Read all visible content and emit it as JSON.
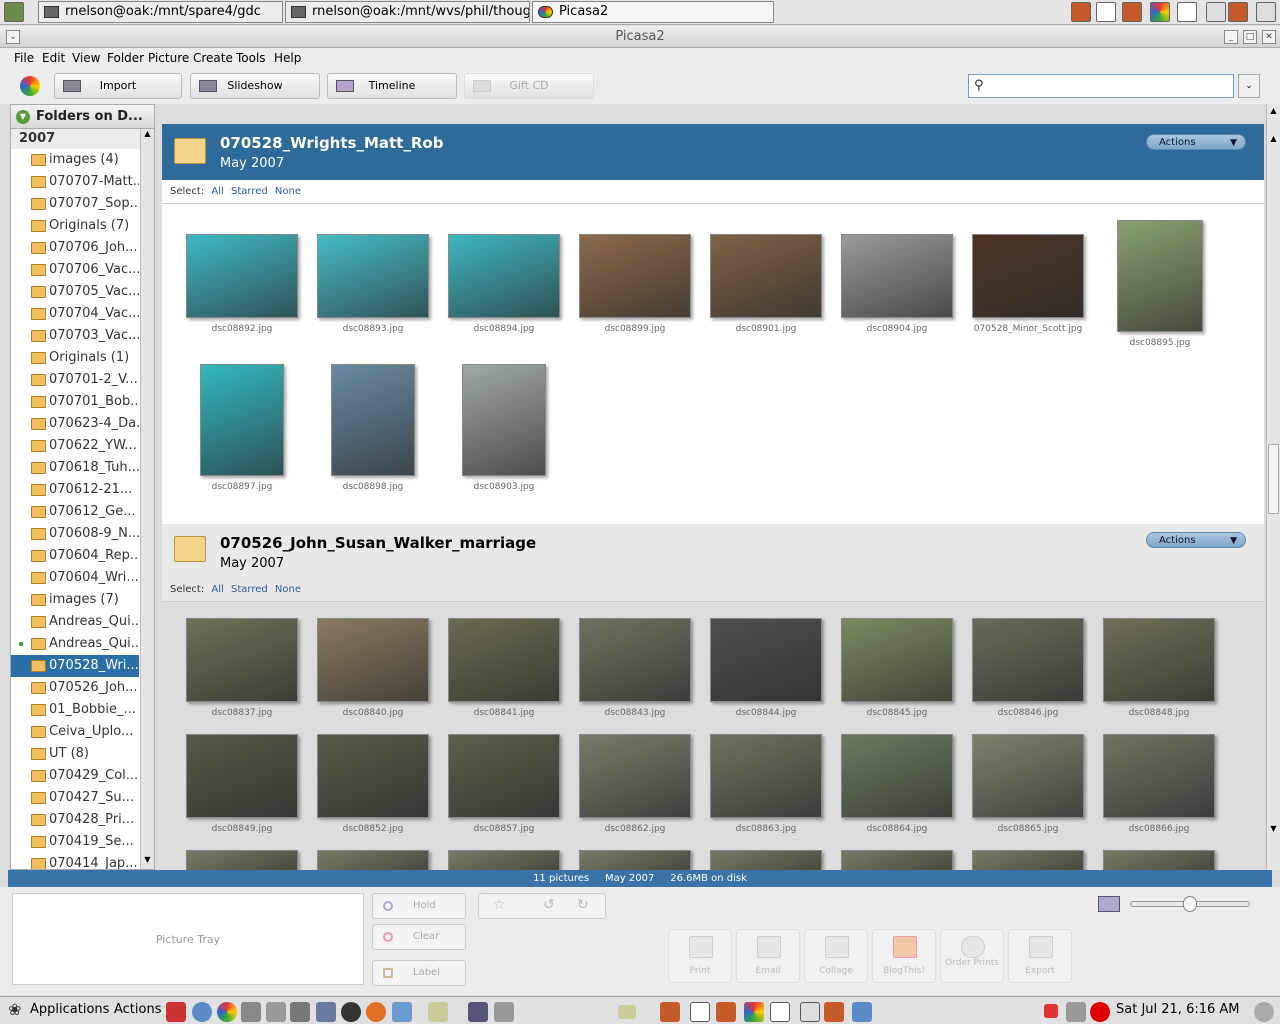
{
  "taskbar": {
    "tasks": [
      {
        "label": "rnelson@oak:/mnt/spare4/gdc"
      },
      {
        "label": "rnelson@oak:/mnt/wvs/phil/thoughtlet"
      },
      {
        "label": "Picasa2"
      }
    ]
  },
  "window": {
    "title": "Picasa2"
  },
  "menu": [
    "File",
    "Edit",
    "View",
    "Folder",
    "Picture",
    "Create",
    "Tools",
    "Help"
  ],
  "toolbar": {
    "import": "Import",
    "slideshow": "Slideshow",
    "timeline": "Timeline",
    "giftcd": "Gift CD",
    "search_value": ""
  },
  "sidebar": {
    "header": "Folders on D...",
    "year": "2007",
    "items": [
      {
        "label": "images (4)"
      },
      {
        "label": "070707-Matt..."
      },
      {
        "label": "070707_Sop..."
      },
      {
        "label": "Originals (7)"
      },
      {
        "label": "070706_Joh..."
      },
      {
        "label": "070706_Vac..."
      },
      {
        "label": "070705_Vac..."
      },
      {
        "label": "070704_Vac..."
      },
      {
        "label": "070703_Vac..."
      },
      {
        "label": "Originals (1)"
      },
      {
        "label": "070701-2_V..."
      },
      {
        "label": "070701_Bob..."
      },
      {
        "label": "070623-4_Da..."
      },
      {
        "label": "070622_YW..."
      },
      {
        "label": "070618_Tuh..."
      },
      {
        "label": "070612-21..."
      },
      {
        "label": "070612_Ge..."
      },
      {
        "label": "070608-9_N..."
      },
      {
        "label": "070604_Rep..."
      },
      {
        "label": "070604_Wri..."
      },
      {
        "label": "images (7)"
      },
      {
        "label": "Andreas_Qui..."
      },
      {
        "label": "Andreas_Qui..."
      },
      {
        "label": "070528_Wri..."
      },
      {
        "label": "070526_Joh..."
      },
      {
        "label": "01_Bobbie_..."
      },
      {
        "label": "Ceiva_Uplo..."
      },
      {
        "label": "UT (8)"
      },
      {
        "label": "070429_Col..."
      },
      {
        "label": "070427_Su..."
      },
      {
        "label": "070428_Pri..."
      },
      {
        "label": "070419_Se..."
      },
      {
        "label": "070414_Jap..."
      }
    ]
  },
  "folder1": {
    "title": "070528_Wrights_Matt_Rob",
    "date": "May 2007",
    "actions": "Actions",
    "select_label": "Select:",
    "select_all": "All",
    "select_starred": "Starred",
    "select_none": "None",
    "photos": [
      {
        "name": "dsc08892.jpg",
        "color": "#3fb9c4"
      },
      {
        "name": "dsc08893.jpg",
        "color": "#45bcc6"
      },
      {
        "name": "dsc08894.jpg",
        "color": "#3eb6bf"
      },
      {
        "name": "dsc08899.jpg",
        "color": "#8a6a4a"
      },
      {
        "name": "dsc08901.jpg",
        "color": "#7d6246"
      },
      {
        "name": "dsc08904.jpg",
        "color": "#9a9a9a"
      },
      {
        "name": "070528_Minor_Scott.jpg",
        "color": "#4a3526"
      },
      {
        "name": "dsc08895.jpg",
        "color": "#8aa070"
      },
      {
        "name": "dsc08897.jpg",
        "color": "#32b8c0"
      },
      {
        "name": "dsc08898.jpg",
        "color": "#6a8aa0"
      },
      {
        "name": "dsc08903.jpg",
        "color": "#a0a8a8"
      }
    ]
  },
  "folder2": {
    "title": "070526_John_Susan_Walker_marriage",
    "date": "May 2007",
    "actions": "Actions",
    "select_label": "Select:",
    "select_all": "All",
    "select_starred": "Starred",
    "select_none": "None",
    "photos": [
      {
        "name": "dsc08837.jpg",
        "color": "#6d7058"
      },
      {
        "name": "dsc08840.jpg",
        "color": "#8a7a60"
      },
      {
        "name": "dsc08841.jpg",
        "color": "#6a6a52"
      },
      {
        "name": "dsc08843.jpg",
        "color": "#707060"
      },
      {
        "name": "dsc08844.jpg",
        "color": "#505050"
      },
      {
        "name": "dsc08845.jpg",
        "color": "#7a8a60"
      },
      {
        "name": "dsc08846.jpg",
        "color": "#6a6a5a"
      },
      {
        "name": "dsc08848.jpg",
        "color": "#6e6e58"
      },
      {
        "name": "dsc08849.jpg",
        "color": "#555a48"
      },
      {
        "name": "dsc08852.jpg",
        "color": "#5a5a4a"
      },
      {
        "name": "dsc08857.jpg",
        "color": "#5e5e4c"
      },
      {
        "name": "dsc08862.jpg",
        "color": "#7a7a6a"
      },
      {
        "name": "dsc08863.jpg",
        "color": "#707060"
      },
      {
        "name": "dsc08864.jpg",
        "color": "#6a7a60"
      },
      {
        "name": "dsc08865.jpg",
        "color": "#80806e"
      },
      {
        "name": "dsc08866.jpg",
        "color": "#707262"
      }
    ]
  },
  "status": {
    "pictures": "11 pictures",
    "date": "May 2007",
    "size": "26.6MB on disk"
  },
  "tray": {
    "label": "Picture Tray",
    "hold": "Hold",
    "clear": "Clear",
    "label_btn": "Label",
    "actions": [
      {
        "label": "Print"
      },
      {
        "label": "Email"
      },
      {
        "label": "Collage"
      },
      {
        "label": "BlogThis!"
      },
      {
        "label": "Order Prints"
      },
      {
        "label": "Export"
      }
    ]
  },
  "panel": {
    "applications": "Applications",
    "actions": "Actions",
    "clock": "Sat Jul 21,  6:16 AM"
  }
}
